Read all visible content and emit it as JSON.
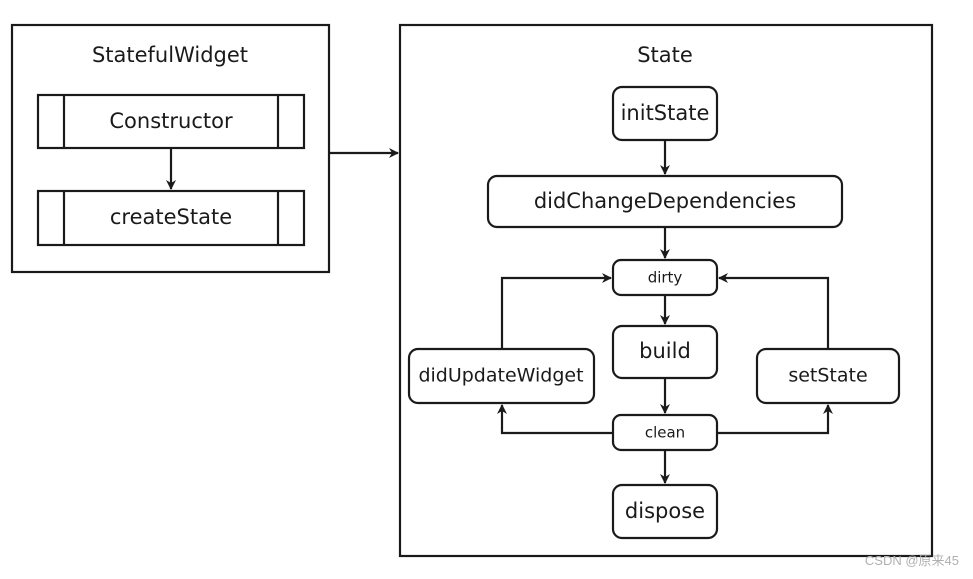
{
  "stateful_widget": {
    "title": "StatefulWidget",
    "steps": [
      "Constructor",
      "createState"
    ]
  },
  "state": {
    "title": "State",
    "nodes": {
      "init_state": "initState",
      "did_change_dependencies": "didChangeDependencies",
      "dirty": "dirty",
      "build": "build",
      "did_update_widget": "didUpdateWidget",
      "set_state": "setState",
      "clean": "clean",
      "dispose": "dispose"
    }
  },
  "watermark": "CSDN @原来45"
}
